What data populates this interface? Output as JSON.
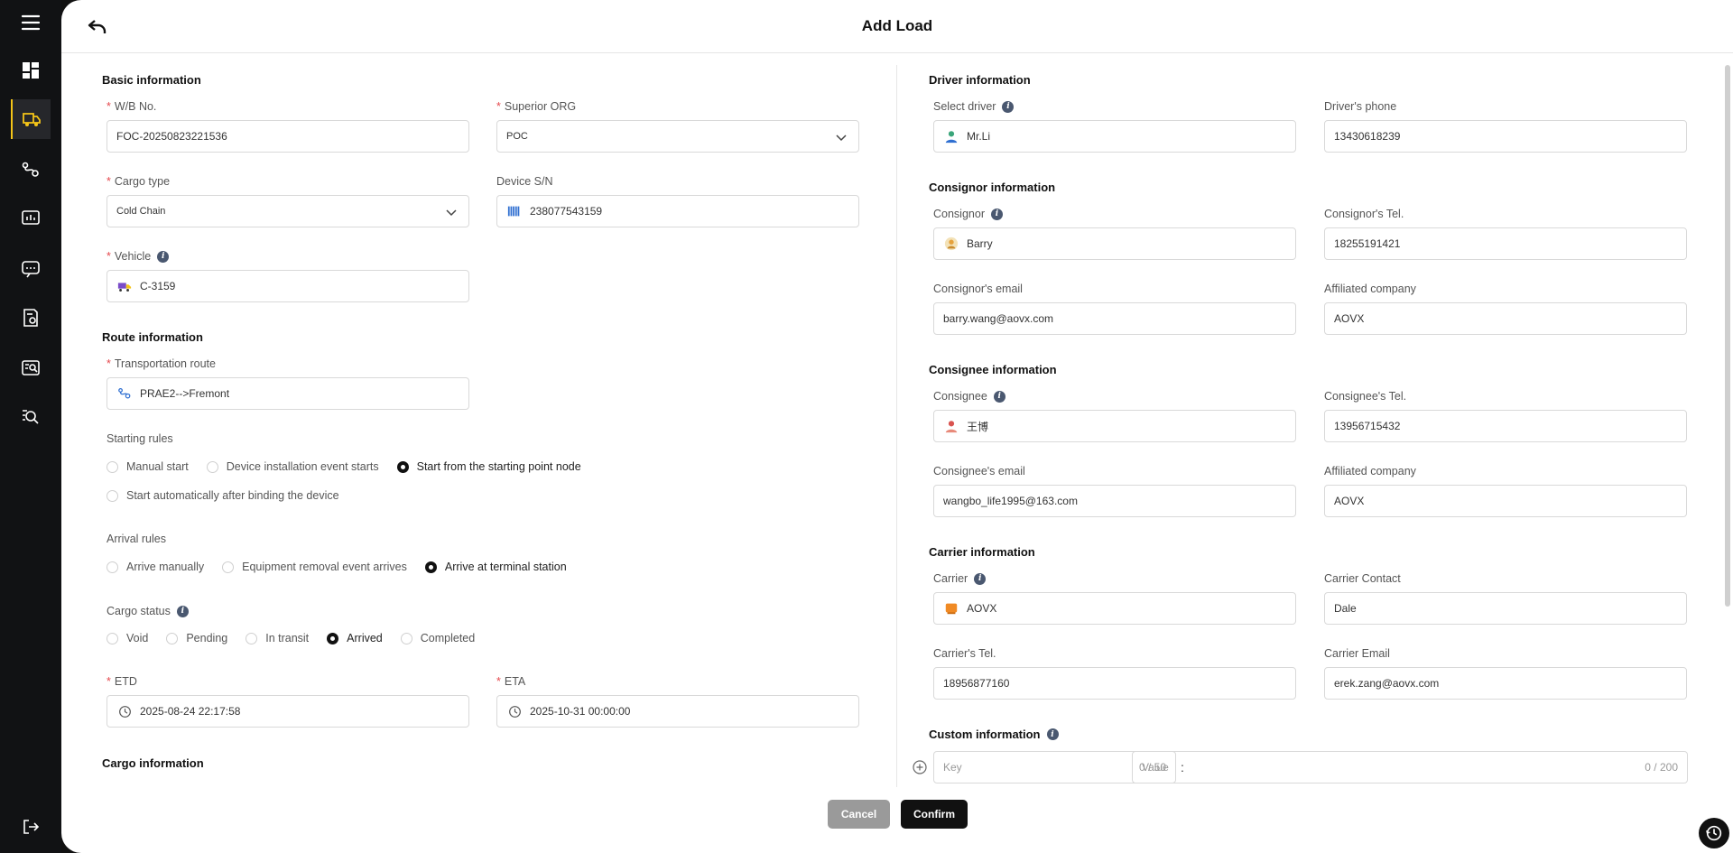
{
  "header": {
    "title": "Add Load"
  },
  "sidebar": {
    "items": [
      "menu-icon",
      "dashboard-icon",
      "truck-load-icon",
      "route-icon",
      "monitor-icon",
      "chat-icon",
      "report-icon",
      "analysis-icon",
      "search-report-icon",
      "logout-icon"
    ]
  },
  "basic": {
    "title": "Basic information",
    "wb_label": "W/B No.",
    "wb_value": "FOC-20250823221536",
    "org_label": "Superior ORG",
    "org_value": "POC",
    "cargo_type_label": "Cargo type",
    "cargo_type_value": "Cold Chain",
    "device_label": "Device S/N",
    "device_value": "238077543159",
    "vehicle_label": "Vehicle",
    "vehicle_value": "C-3159"
  },
  "route": {
    "title": "Route information",
    "route_label": "Transportation route",
    "route_value": "PRAE2-->Fremont",
    "starting_label": "Starting rules",
    "starting_options": [
      "Manual start",
      "Device installation event starts",
      "Start from the starting point node",
      "Start automatically after binding the device"
    ],
    "starting_selected": "Start from the starting point node",
    "arrival_label": "Arrival rules",
    "arrival_options": [
      "Arrive manually",
      "Equipment removal event arrives",
      "Arrive at terminal station"
    ],
    "arrival_selected": "Arrive at terminal station",
    "status_label": "Cargo status",
    "status_options": [
      "Void",
      "Pending",
      "In transit",
      "Arrived",
      "Completed"
    ],
    "status_selected": "Arrived",
    "etd_label": "ETD",
    "etd_value": "2025-08-24 22:17:58",
    "eta_label": "ETA",
    "eta_value": "2025-10-31 00:00:00"
  },
  "cargo": {
    "title": "Cargo information"
  },
  "driver": {
    "title": "Driver information",
    "select_label": "Select driver",
    "select_value": "Mr.Li",
    "phone_label": "Driver's phone",
    "phone_value": "13430618239"
  },
  "consignor": {
    "title": "Consignor information",
    "name_label": "Consignor",
    "name_value": "Barry",
    "tel_label": "Consignor's Tel.",
    "tel_value": "18255191421",
    "email_label": "Consignor's email",
    "email_value": "barry.wang@aovx.com",
    "company_label": "Affiliated company",
    "company_value": "AOVX"
  },
  "consignee": {
    "title": "Consignee information",
    "name_label": "Consignee",
    "name_value": "王博",
    "tel_label": "Consignee's Tel.",
    "tel_value": "13956715432",
    "email_label": "Consignee's email",
    "email_value": "wangbo_life1995@163.com",
    "company_label": "Affiliated company",
    "company_value": "AOVX"
  },
  "carrier": {
    "title": "Carrier information",
    "name_label": "Carrier",
    "name_value": "AOVX",
    "contact_label": "Carrier Contact",
    "contact_value": "Dale",
    "tel_label": "Carrier's Tel.",
    "tel_value": "18956877160",
    "email_label": "Carrier Email",
    "email_value": "erek.zang@aovx.com"
  },
  "custom": {
    "title": "Custom information",
    "key_placeholder": "Key",
    "key_count": "0 / 50",
    "value_placeholder": "Value",
    "value_count": "0 / 200"
  },
  "footer": {
    "cancel_label": "Cancel",
    "confirm_label": "Confirm"
  },
  "colors": {
    "accent": "#f5c518",
    "required": "#e5484d",
    "primary_button": "#111111",
    "cancel_button": "#9a9a9a"
  }
}
